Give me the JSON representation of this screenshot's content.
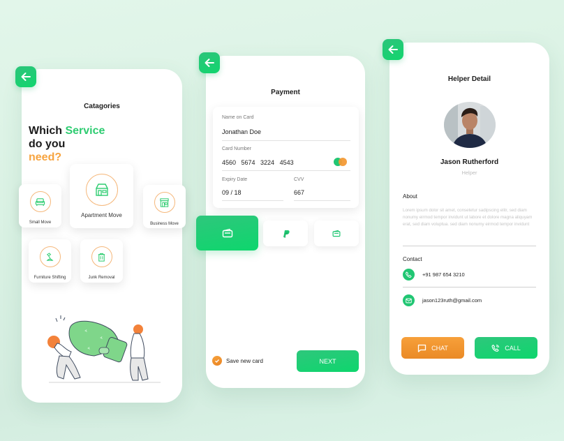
{
  "colors": {
    "primary_green": "#21C673",
    "accent_orange": "#F59E39",
    "background": "#DDF3E6"
  },
  "categories_screen": {
    "back_icon": "arrow-left-icon",
    "title": "Catagories",
    "headline": {
      "part1": "Which ",
      "highlight1": "Service",
      "line2": "do you",
      "highlight2": "need?"
    },
    "categories": [
      {
        "label": "Small Move",
        "icon": "sofa-icon"
      },
      {
        "label": "Apartment Move",
        "icon": "house-icon",
        "selected": true
      },
      {
        "label": "Business Move",
        "icon": "storefront-icon"
      },
      {
        "label": "Furniture Shifting",
        "icon": "lamp-icon"
      },
      {
        "label": "Junk Removal",
        "icon": "trash-icon"
      }
    ],
    "illustration": "movers-carrying-bag-illustration"
  },
  "payment_screen": {
    "back_icon": "arrow-left-icon",
    "title": "Payment",
    "form": {
      "name_label": "Name on Card",
      "name_value": "Jonathan Doe",
      "number_label": "Card Number",
      "number_value": "4560   5674   3224   4543",
      "card_brand_icon": "mastercard-icon",
      "expiry_label": "Expiry Date",
      "expiry_value": "09 / 18",
      "cvv_label": "CVV",
      "cvv_value": "667"
    },
    "payment_methods": [
      {
        "icon": "wallet-card-icon",
        "active": true
      },
      {
        "icon": "paypal-icon",
        "active": false
      },
      {
        "icon": "wallet-icon",
        "active": false
      }
    ],
    "save_card_label": "Save new card",
    "save_card_checked": true,
    "next_label": "NEXT"
  },
  "helper_screen": {
    "back_icon": "arrow-left-icon",
    "title": "Helper Detail",
    "name": "Jason Rutherford",
    "role": "Helper",
    "about_title": "About",
    "about_text": "Lorem ipsum dolor sit amet, consetetur sadipscing elitr, sed diam nonumy eirmod tempor invidunt ut labore et dolore magna aliquyam erat, sed diam voluptua. sed diam nonumy eirmod tempor invidunt",
    "contact_title": "Contact",
    "phone": "+91 987 654 3210",
    "email": "jason123ruth@gmail.com",
    "chat_label": "CHAT",
    "call_label": "CALL"
  }
}
